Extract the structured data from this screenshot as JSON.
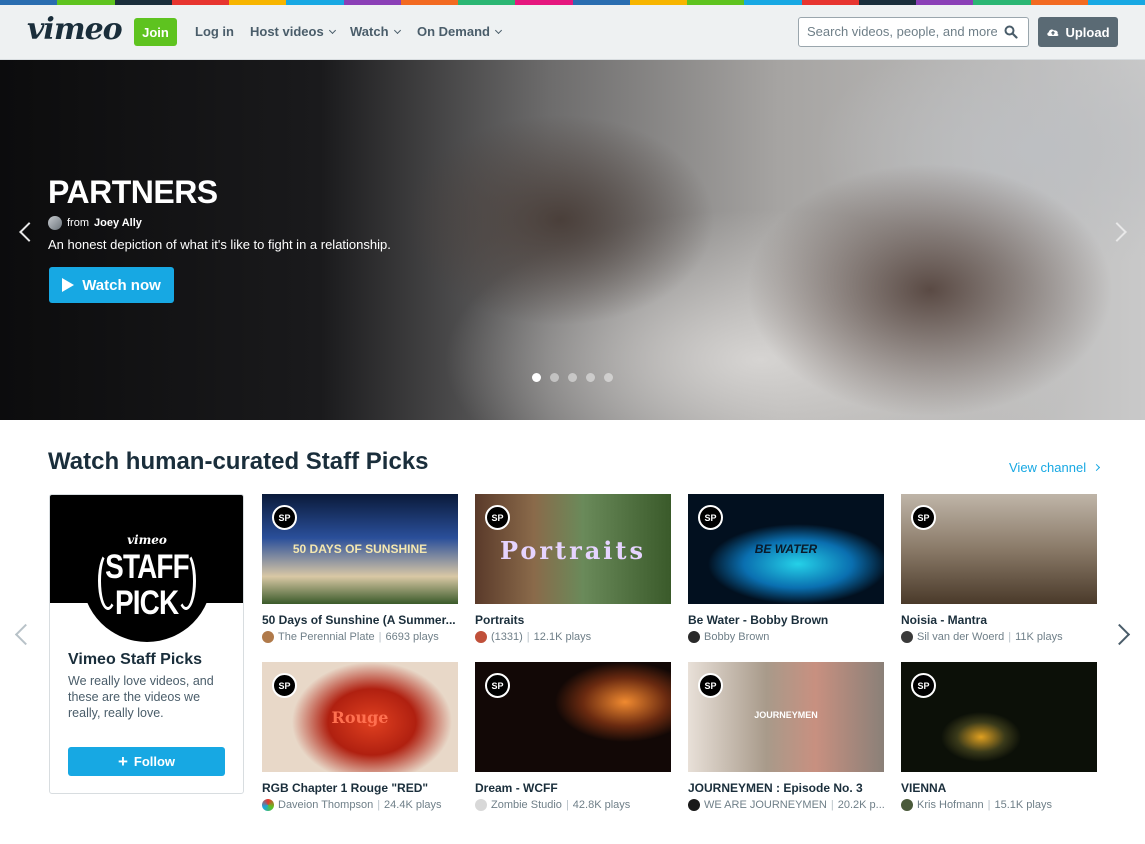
{
  "header": {
    "logo": "vimeo",
    "join_label": "Join",
    "login_label": "Log in",
    "nav": [
      "Host videos",
      "Watch",
      "On Demand"
    ],
    "search_placeholder": "Search videos, people, and more",
    "upload_label": "Upload"
  },
  "hero": {
    "title": "PARTNERS",
    "from_prefix": "from",
    "author": "Joey Ally",
    "description": "An honest depiction of what it's like to fight in a relationship.",
    "watch_label": "Watch now",
    "slide_count": 5,
    "active_slide": 1
  },
  "staff_picks": {
    "title": "Watch human-curated Staff Picks",
    "view_channel": "View channel",
    "channel": {
      "badge_brand": "vimeo",
      "badge_text_1": "STAFF",
      "badge_text_2": "PICK",
      "name": "Vimeo Staff Picks",
      "description": "We really love videos, and these are the videos we really, really love.",
      "follow_label": "Follow"
    },
    "videos": [
      {
        "title": "50 Days of Sunshine (A Summer...",
        "author": "The Perennial Plate",
        "plays": "6693 plays",
        "overlay": "50 DAYS OF SUNSHINE",
        "mark": "SP"
      },
      {
        "title": "Portraits",
        "author": "(1331)",
        "plays": "12.1K plays",
        "overlay": "Portraits",
        "mark": "SP"
      },
      {
        "title": "Be Water - Bobby Brown",
        "author": "Bobby Brown",
        "plays": "",
        "overlay": "BE WATER",
        "mark": "SP"
      },
      {
        "title": "Noisia - Mantra",
        "author": "Sil van der Woerd",
        "plays": "11K plays",
        "overlay": "",
        "mark": "SP"
      },
      {
        "title": "RGB Chapter 1 Rouge \"RED\"",
        "author": "Daveion Thompson",
        "plays": "24.4K plays",
        "overlay": "Rouge",
        "mark": "SP"
      },
      {
        "title": "Dream - WCFF",
        "author": "Zombie Studio",
        "plays": "42.8K plays",
        "overlay": "",
        "mark": "SP"
      },
      {
        "title": "JOURNEYMEN : Episode No. 3",
        "author": "WE ARE JOURNEYMEN",
        "plays": "20.2K p...",
        "overlay": "JOURNEYMEN",
        "mark": "SP"
      },
      {
        "title": "VIENNA",
        "author": "Kris Hofmann",
        "plays": "15.1K plays",
        "overlay": "",
        "mark": "SP"
      }
    ]
  },
  "colors": {
    "accent_blue": "#17a8e3",
    "join_green": "#5ec31f",
    "text_dark": "#1a2e3b",
    "strip": [
      "#2a6db0",
      "#5ec31f",
      "#e7352f",
      "#f7b500",
      "#1a2e3b",
      "#17a8e3",
      "#8a3fb6",
      "#f26a21",
      "#2bb673",
      "#e5177e"
    ]
  }
}
